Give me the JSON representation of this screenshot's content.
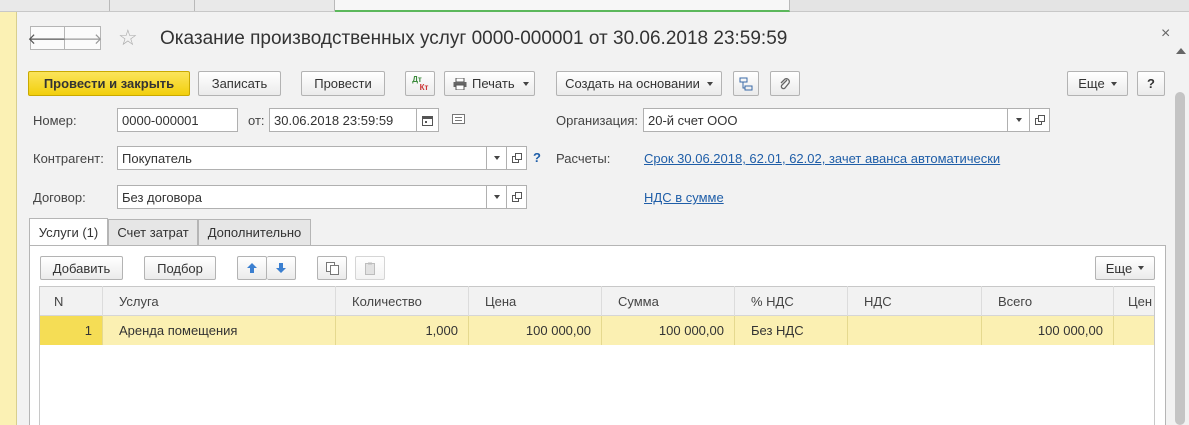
{
  "window": {
    "title": "Оказание производственных услуг 0000-000001 от 30.06.2018 23:59:59",
    "close_glyph": "×",
    "back_glyph": "🡐",
    "forward_glyph": "🡒",
    "favorite_glyph": "☆"
  },
  "toolbar": {
    "post_and_close": "Провести и закрыть",
    "save": "Записать",
    "post": "Провести",
    "dt_kt_top": "Дт",
    "dt_kt_bottom": "Кт",
    "print": "Печать",
    "create_based_on": "Создать на основании",
    "more": "Еще",
    "help": "?"
  },
  "form": {
    "number_label": "Номер:",
    "number_value": "0000-000001",
    "date_label": "от:",
    "date_value": "30.06.2018 23:59:59",
    "organization_label": "Организация:",
    "organization_value": "20-й счет ООО",
    "counterparty_label": "Контрагент:",
    "counterparty_value": "Покупатель",
    "counterparty_help": "?",
    "settlements_label": "Расчеты:",
    "settlements_link": "Срок 30.06.2018, 62.01, 62.02, зачет аванса автоматически",
    "contract_label": "Договор:",
    "contract_value": "Без договора",
    "vat_link": "НДС в сумме"
  },
  "tabs": [
    {
      "label": "Услуги (1)",
      "active": true
    },
    {
      "label": "Счет затрат",
      "active": false
    },
    {
      "label": "Дополнительно",
      "active": false
    }
  ],
  "table_toolbar": {
    "add": "Добавить",
    "pick": "Подбор",
    "more": "Еще"
  },
  "table": {
    "columns": [
      "N",
      "Услуга",
      "Количество",
      "Цена",
      "Сумма",
      "% НДС",
      "НДС",
      "Всего",
      "Цен"
    ],
    "rows": [
      {
        "n": "1",
        "service": "Аренда помещения",
        "quantity": "1,000",
        "price": "100 000,00",
        "sum": "100 000,00",
        "vat_rate": "Без НДС",
        "vat": "",
        "total": "100 000,00",
        "extra": ""
      }
    ]
  },
  "colors": {
    "primary_button": "#f2cf0c",
    "link": "#1f5ea8",
    "selected_row": "#fbf0b2",
    "active_tab_underline": "#5cb85c"
  }
}
